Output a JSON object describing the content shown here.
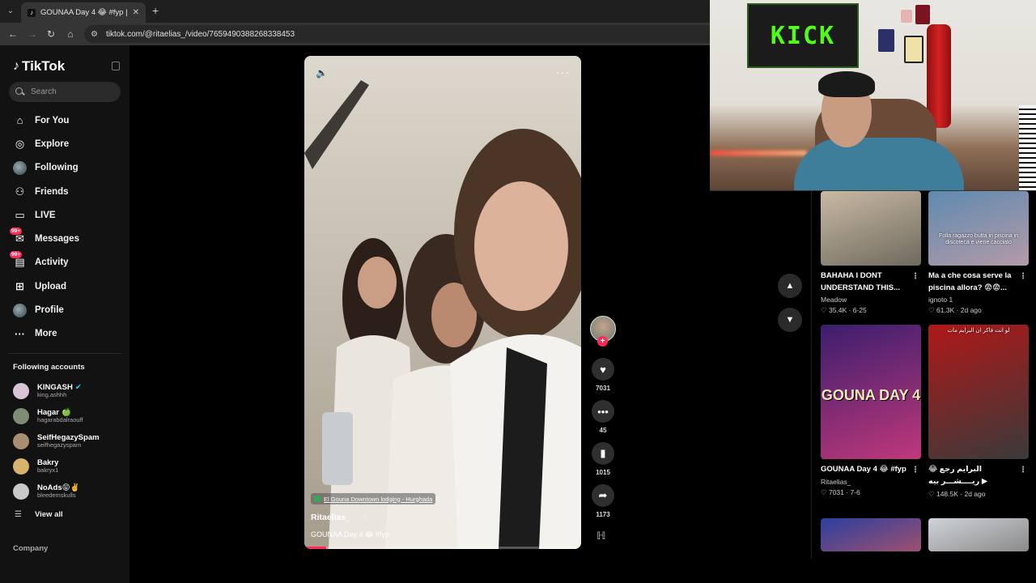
{
  "browser": {
    "tab_title": "GOUNAA Day 4 😂 #fyp | T",
    "url": "tiktok.com/@ritaelias_/video/7659490388268338453"
  },
  "sidebar": {
    "logo": "TikTok",
    "search_placeholder": "Search",
    "nav": [
      {
        "label": "For You",
        "icon": "home-icon",
        "glyph": "⌂"
      },
      {
        "label": "Explore",
        "icon": "compass-icon",
        "glyph": "◎"
      },
      {
        "label": "Following",
        "icon": "avatar",
        "glyph": ""
      },
      {
        "label": "Friends",
        "icon": "friends-icon",
        "glyph": "⚇"
      },
      {
        "label": "LIVE",
        "icon": "live-icon",
        "glyph": "▭"
      },
      {
        "label": "Messages",
        "icon": "messages-icon",
        "glyph": "✉",
        "badge": "99+"
      },
      {
        "label": "Activity",
        "icon": "activity-icon",
        "glyph": "▤",
        "badge": "99+"
      },
      {
        "label": "Upload",
        "icon": "upload-icon",
        "glyph": "⊞"
      },
      {
        "label": "Profile",
        "icon": "avatar",
        "glyph": ""
      },
      {
        "label": "More",
        "icon": "more-icon",
        "glyph": "···"
      }
    ],
    "following_title": "Following accounts",
    "accounts": [
      {
        "name": "KINGASH",
        "handle": "king.ashhh",
        "mark": "✔",
        "mark_color": "#20d5ec",
        "color": "#d9c3d7"
      },
      {
        "name": "Hagar",
        "handle": "hagarabdalraouff",
        "mark": "🍏",
        "mark_color": "#7cc043",
        "color": "#7e8c76"
      },
      {
        "name": "SeifHegazySpam",
        "handle": "seifhegazyspam",
        "mark": "",
        "mark_color": "",
        "color": "#a88d70"
      },
      {
        "name": "Bakry",
        "handle": "bakryx1",
        "mark": "",
        "mark_color": "",
        "color": "#d7b46a"
      },
      {
        "name": "NoAds😝✌️",
        "handle": "bleedemskulls",
        "mark": "",
        "mark_color": "",
        "color": "#c9c9c9"
      }
    ],
    "view_all": "View all",
    "company": "Company"
  },
  "video": {
    "location": "El Gouna Downtown lodging - Hurghada",
    "author": "Ritaelias_",
    "date": " · 7-6",
    "caption": "GOUNAA Day 4 😂 #fyp",
    "progress": 0.08
  },
  "actions": {
    "likes": "7031",
    "comments": "45",
    "saves": "1015",
    "shares": "1173"
  },
  "grid": [
    {
      "title": "BAHAHA I DONT UNDERSTAND THIS...",
      "channel": "Meadow",
      "stats": "♡ 35.4K · 6-25",
      "colors": [
        "#c9b9a4",
        "#6f6a5e"
      ],
      "overlay": ""
    },
    {
      "title": "Ma a che cosa serve la piscina allora? 😨😨...",
      "channel": "ignoto 1",
      "stats": "♡ 61.3K · 2d ago",
      "colors": [
        "#5f8ab0",
        "#b49aa7"
      ],
      "overlay": "Folla ragazzo butta in piscina in discoteca e viene cacciato"
    },
    {
      "title": "GOUNAA Day 4 😂 #fyp",
      "channel": "Ritaelias_",
      "stats": "♡ 7031 · 7-6",
      "colors": [
        "#3b1e6e",
        "#c0387a"
      ],
      "overlay": "GOUNA DAY 4"
    },
    {
      "title": "البرايم رجع 😂 ريــــشـــر بيه ▶",
      "channel": "",
      "stats": "♡ 148.5K · 2d ago",
      "colors": [
        "#b01818",
        "#3a3a3a"
      ],
      "overlay": "لو انت فاكر ان البرايم مات"
    },
    {
      "title": "",
      "channel": "",
      "stats": "",
      "colors": [
        "#2a3fa0",
        "#a05070"
      ],
      "overlay": ""
    },
    {
      "title": "",
      "channel": "",
      "stats": "",
      "colors": [
        "#cfd3d8",
        "#8a8a8a"
      ],
      "overlay": ""
    }
  ],
  "colors": {
    "accent": "#fe2c55",
    "bg": "#000000",
    "sidebar_bg": "#121212"
  }
}
